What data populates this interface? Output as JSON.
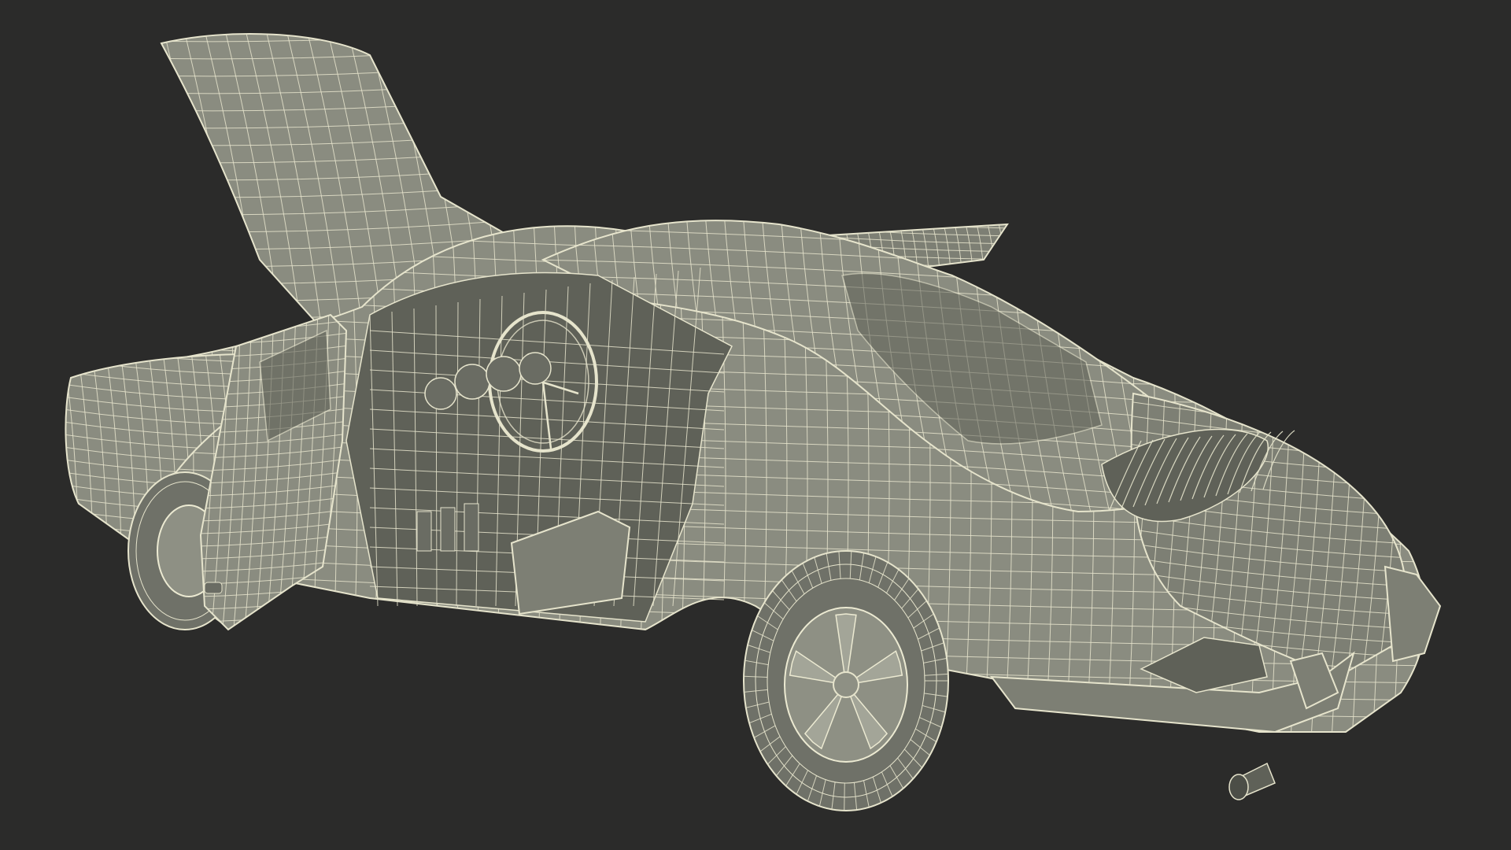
{
  "scene": {
    "subject": "classic-coupe-wireframe",
    "colors": {
      "background": "#2b2b2a",
      "surface": "#8a8c80",
      "wire": "#e6e4cc"
    }
  }
}
